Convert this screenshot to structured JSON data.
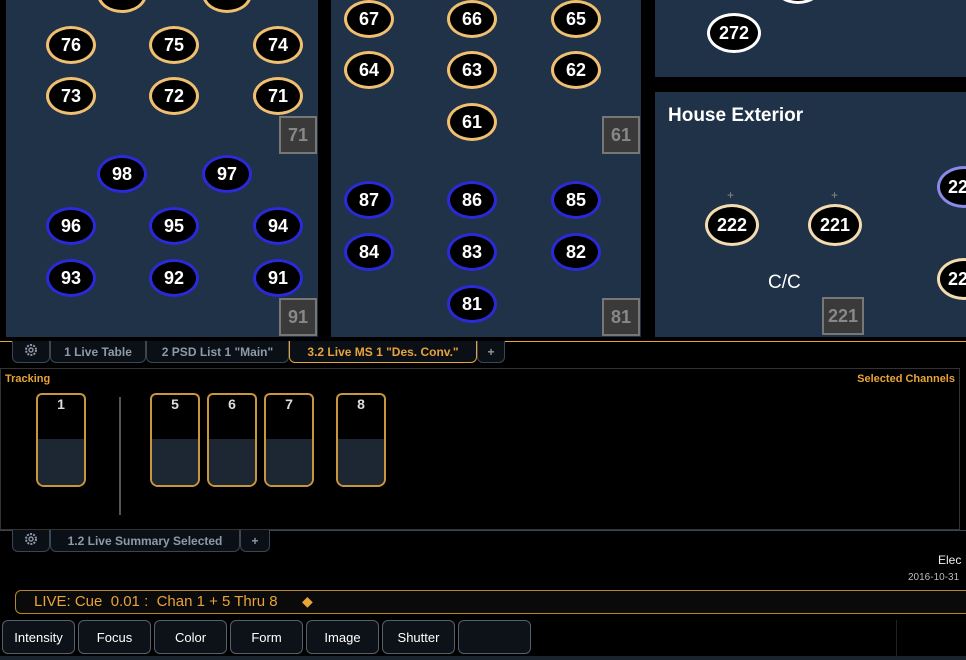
{
  "magic_sheet": {
    "panel_left": {
      "channels_amber": [
        "76",
        "75",
        "74",
        "73",
        "72",
        "71"
      ],
      "channels_blue": [
        "98",
        "97",
        "96",
        "95",
        "94",
        "93",
        "92",
        "91"
      ],
      "groups": [
        "71",
        "91"
      ]
    },
    "panel_mid": {
      "channels_amber": [
        "67",
        "66",
        "65",
        "64",
        "63",
        "62",
        "61"
      ],
      "channels_blue": [
        "87",
        "86",
        "85",
        "84",
        "83",
        "82",
        "81"
      ],
      "groups": [
        "61",
        "81"
      ]
    },
    "panel_right_top": {
      "channel": "272"
    },
    "house_exterior": {
      "title": "House Exterior",
      "channels": [
        "222",
        "221",
        "22",
        "22"
      ],
      "label": "C/C",
      "group": "221"
    }
  },
  "top_tabs": [
    {
      "label": "1 Live Table"
    },
    {
      "label": "2 PSD List 1 \"Main\""
    },
    {
      "label": "3.2 Live MS 1 \"Des. Conv.\""
    },
    {
      "label": "+"
    }
  ],
  "tracking": {
    "title": "Tracking",
    "selected_title": "Selected Channels",
    "faders": [
      "1",
      "5",
      "6",
      "7",
      "8"
    ]
  },
  "bottom_tabs": [
    {
      "label": "1.2 Live Summary Selected"
    },
    {
      "label": "+"
    }
  ],
  "info": {
    "right_text": "Elec",
    "date": "2016-10-31"
  },
  "command_line": "LIVE: Cue  0.01 :  Chan 1 + 5 Thru 8",
  "softkeys": [
    "Intensity",
    "Focus",
    "Color",
    "Form",
    "Image",
    "Shutter",
    ""
  ],
  "colors": {
    "accent": "#e8a33a",
    "panel": "#1f3247",
    "selected": "#f0c070",
    "blue": "#2a2ad8"
  }
}
